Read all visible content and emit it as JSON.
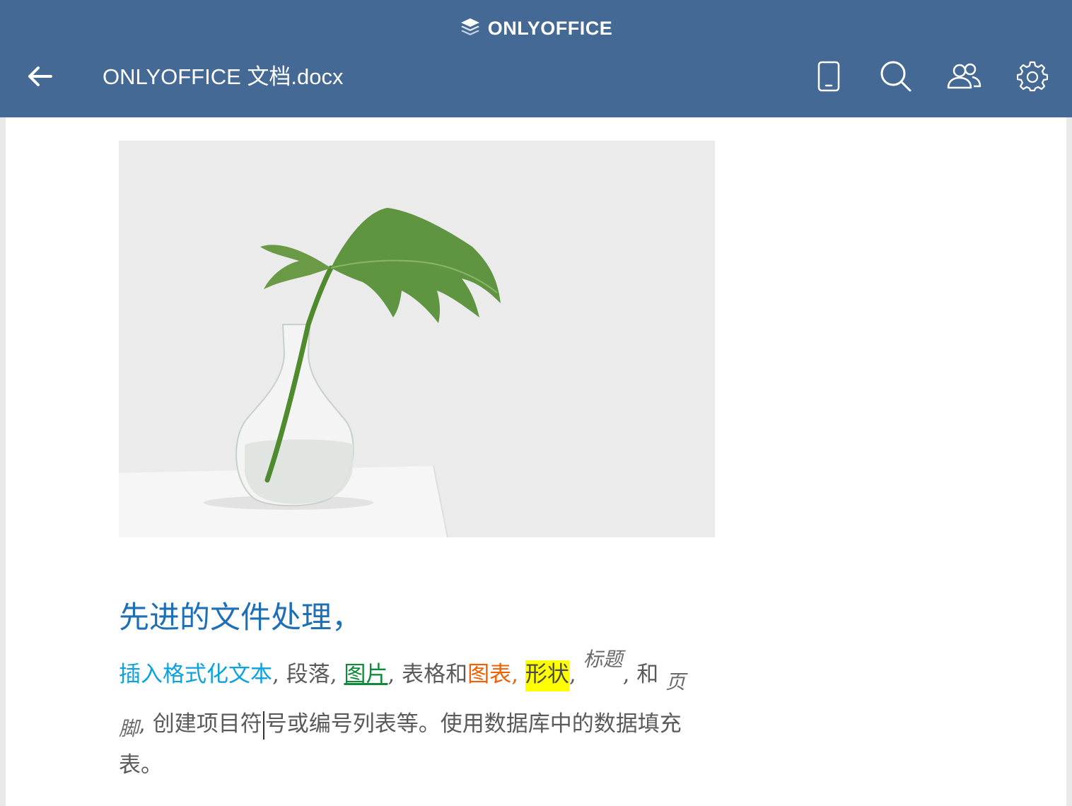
{
  "header": {
    "brand": "ONLYOFFICE",
    "document_title": "ONLYOFFICE 文档.docx",
    "background_color": "#446995",
    "icons": {
      "back": "arrow-left-icon",
      "mobile_view": "smartphone-icon",
      "search": "search-icon",
      "collaboration": "users-icon",
      "settings": "gear-icon"
    }
  },
  "document": {
    "image_description_icon": "plant-in-vase-image",
    "heading": "先进的文件处理，",
    "heading_color": "#1f6fb4",
    "paragraph": {
      "line1": {
        "s1": "插入格式化文本",
        "s2": ", 段落, ",
        "s3": "图片",
        "s4": ", 表格和",
        "s5": "图表, ",
        "s6": "形状",
        "s7": ", ",
        "s8": "标题",
        "s9": ", 和 ",
        "s10": "页"
      },
      "line2": {
        "s1": "脚",
        "s2": ", 创建项目符",
        "s3": "号或编号列表等。使用数据库中的数据填充"
      },
      "line3": {
        "s1": "表。"
      }
    },
    "colors": {
      "link_blue": "#0ba2e0",
      "green": "#0f8a3a",
      "orange": "#f06000",
      "highlight": "#ffff00"
    }
  }
}
